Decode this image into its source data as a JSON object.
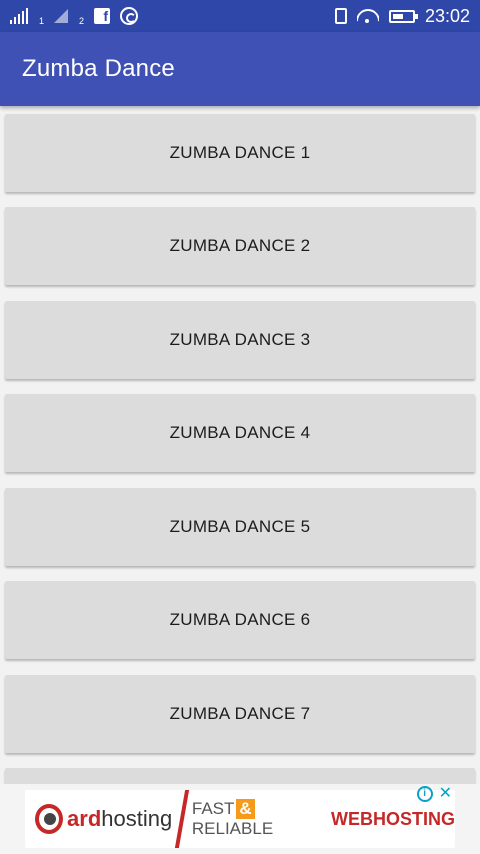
{
  "status_bar": {
    "sim1_label": "1",
    "sim2_label": "2",
    "time": "23:02"
  },
  "app_bar": {
    "title": "Zumba Dance"
  },
  "list": {
    "items": [
      {
        "label": "ZUMBA DANCE 1"
      },
      {
        "label": "ZUMBA DANCE 2"
      },
      {
        "label": "ZUMBA DANCE 3"
      },
      {
        "label": "ZUMBA DANCE 4"
      },
      {
        "label": "ZUMBA DANCE 5"
      },
      {
        "label": "ZUMBA DANCE 6"
      },
      {
        "label": "ZUMBA DANCE 7"
      }
    ]
  },
  "ad": {
    "brand_bold": "ard",
    "brand_rest": "hosting",
    "tag_fast": "FAST",
    "tag_amp": "&",
    "tag_reliable": "RELIABLE",
    "tag_web": "WEBHOSTING"
  },
  "colors": {
    "status_bar": "#2f47a8",
    "app_bar": "#3f51b5",
    "button_bg": "#dcdcdc",
    "ad_accent": "#c62828"
  }
}
